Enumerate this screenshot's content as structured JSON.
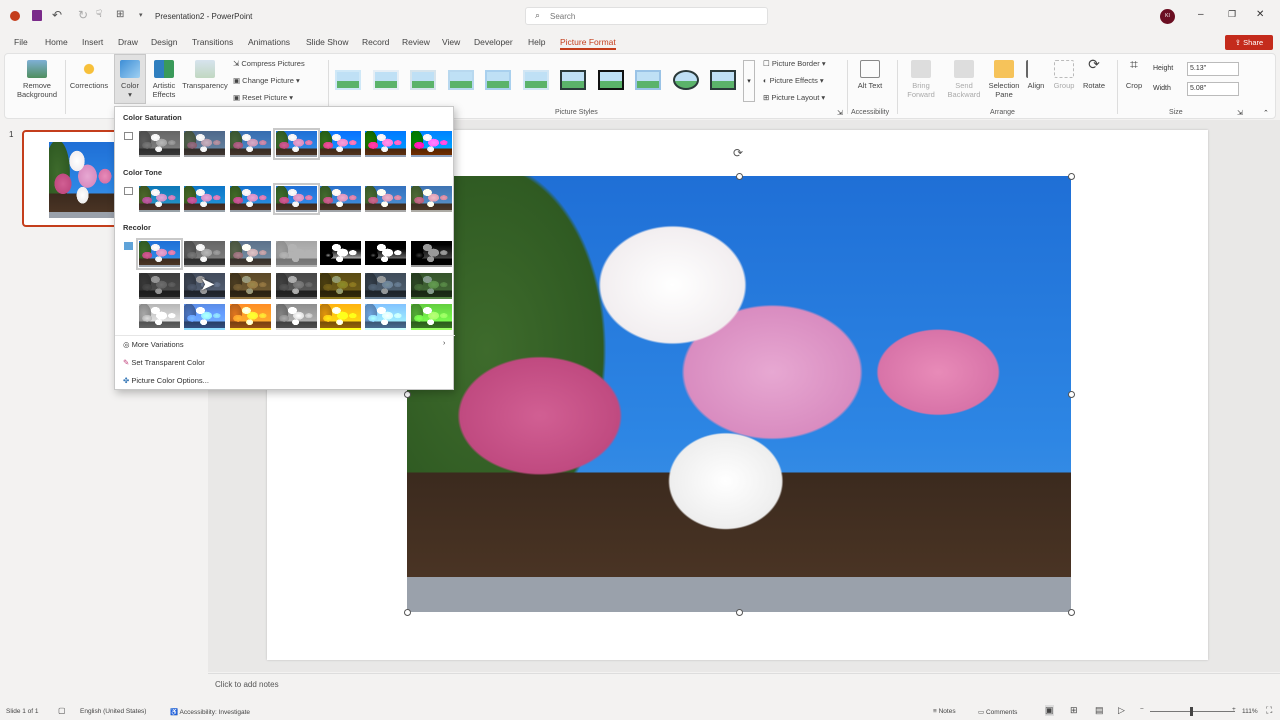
{
  "titlebar": {
    "doc_title": "Presentation2 - PowerPoint",
    "search_placeholder": "Search",
    "user_initials": "KI",
    "minimize": "–",
    "restore": "❐",
    "close": "✕",
    "share": "Share"
  },
  "tabs": [
    "File",
    "Home",
    "Insert",
    "Draw",
    "Design",
    "Transitions",
    "Animations",
    "Slide Show",
    "Record",
    "Review",
    "View",
    "Developer",
    "Help",
    "Picture Format"
  ],
  "ribbon": {
    "remove_background": "Remove Background",
    "corrections": "Corrections",
    "color": "Color",
    "artistic_effects": "Artistic Effects",
    "transparency": "Transparency",
    "compress_pictures": "Compress Pictures",
    "change_picture": "Change Picture",
    "reset_picture": "Reset Picture",
    "picture_border": "Picture Border",
    "picture_effects": "Picture Effects",
    "picture_layout": "Picture Layout",
    "picture_styles_group": "Picture Styles",
    "alt_text": "Alt Text",
    "accessibility_group": "Accessibility",
    "bring_forward": "Bring Forward",
    "send_backward": "Send Backward",
    "selection_pane": "Selection Pane",
    "align": "Align",
    "group": "Group",
    "rotate": "Rotate",
    "arrange_group": "Arrange",
    "crop": "Crop",
    "height_label": "Height",
    "height_value": "5.13\"",
    "width_label": "Width",
    "width_value": "5.08\"",
    "size_group": "Size"
  },
  "thumbnails": [
    {
      "number": "1"
    }
  ],
  "color_menu": {
    "color_saturation": "Color Saturation",
    "color_tone": "Color Tone",
    "recolor": "Recolor",
    "more_variations": "More Variations",
    "set_transparent_color": "Set Transparent Color",
    "picture_color_options": "Picture Color Options..."
  },
  "notes_placeholder": "Click to add notes",
  "status": {
    "slide": "Slide 1 of 1",
    "language": "English (United States)",
    "accessibility": "Accessibility: Investigate",
    "notes": "Notes",
    "comments": "Comments",
    "zoom": "111%"
  }
}
